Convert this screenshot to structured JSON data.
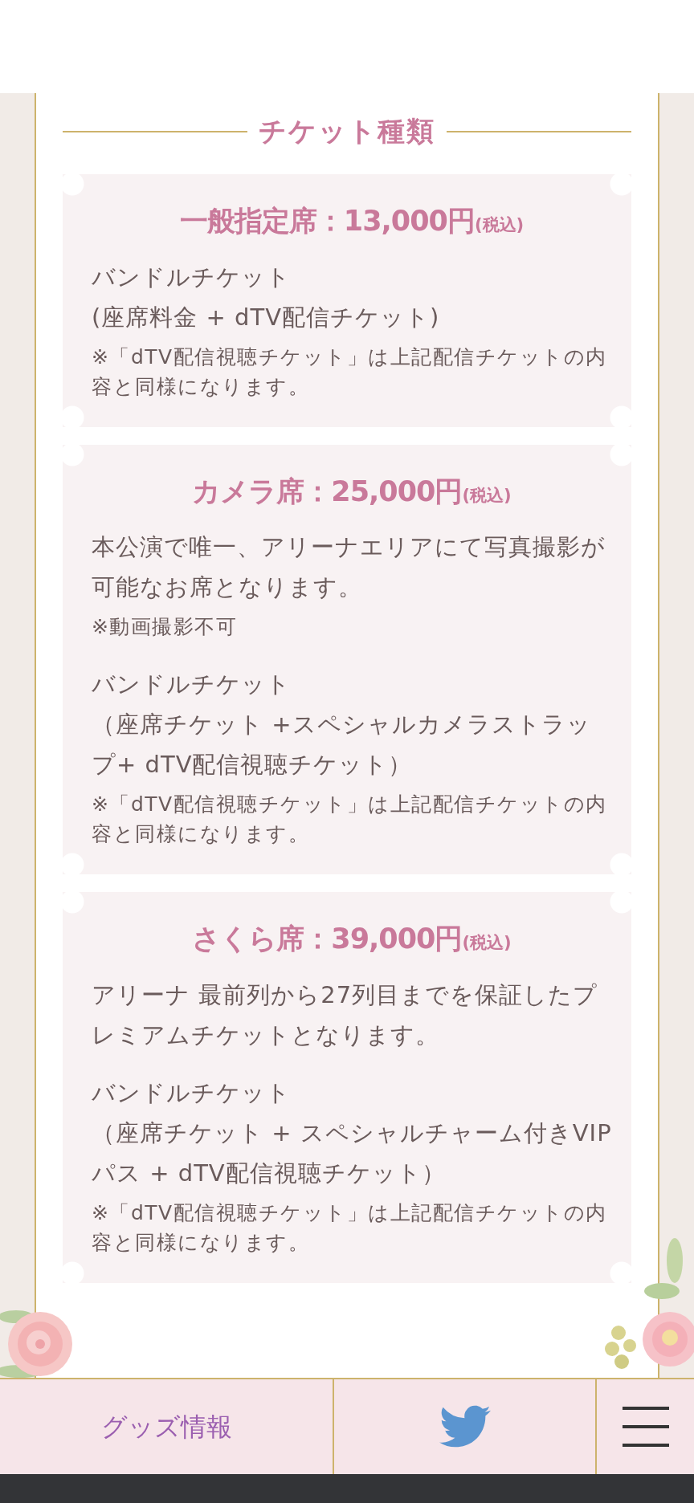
{
  "section_title": "チケット種類",
  "tickets": [
    {
      "title": "一般指定席：13,000円",
      "tax": "(税込)",
      "blocks": [
        {
          "kind": "body",
          "lines": [
            "バンドルチケット",
            "(座席料金 + dTV配信チケット)"
          ]
        },
        {
          "kind": "note",
          "lines": [
            "※「dTV配信視聴チケット」は上記配信チケットの内容と同様になります。"
          ]
        }
      ]
    },
    {
      "title": "カメラ席：25,000円",
      "tax": "(税込)",
      "blocks": [
        {
          "kind": "body",
          "lines": [
            "本公演で唯一、アリーナエリアにて写真撮影が可能なお席となります。"
          ]
        },
        {
          "kind": "note",
          "lines": [
            "※動画撮影不可"
          ]
        },
        {
          "kind": "body",
          "lines": [
            "バンドルチケット",
            "（座席チケット +スペシャルカメラストラップ+ dTV配信視聴チケット）"
          ]
        },
        {
          "kind": "note",
          "lines": [
            "※「dTV配信視聴チケット」は上記配信チケットの内容と同様になります。"
          ]
        }
      ]
    },
    {
      "title": "さくら席：39,000円",
      "tax": "(税込)",
      "blocks": [
        {
          "kind": "body",
          "lines": [
            "アリーナ 最前列から27列目までを保証したプレミアムチケットとなります。"
          ]
        },
        {
          "kind": "body",
          "lines": [
            "バンドルチケット",
            "（座席チケット + スペシャルチャーム付きVIPパス + dTV配信視聴チケット）"
          ]
        },
        {
          "kind": "note",
          "lines": [
            "※「dTV配信視聴チケット」は上記配信チケットの内容と同様になります。"
          ]
        }
      ]
    }
  ],
  "bottom_nav": {
    "link": "グッズ情報"
  }
}
